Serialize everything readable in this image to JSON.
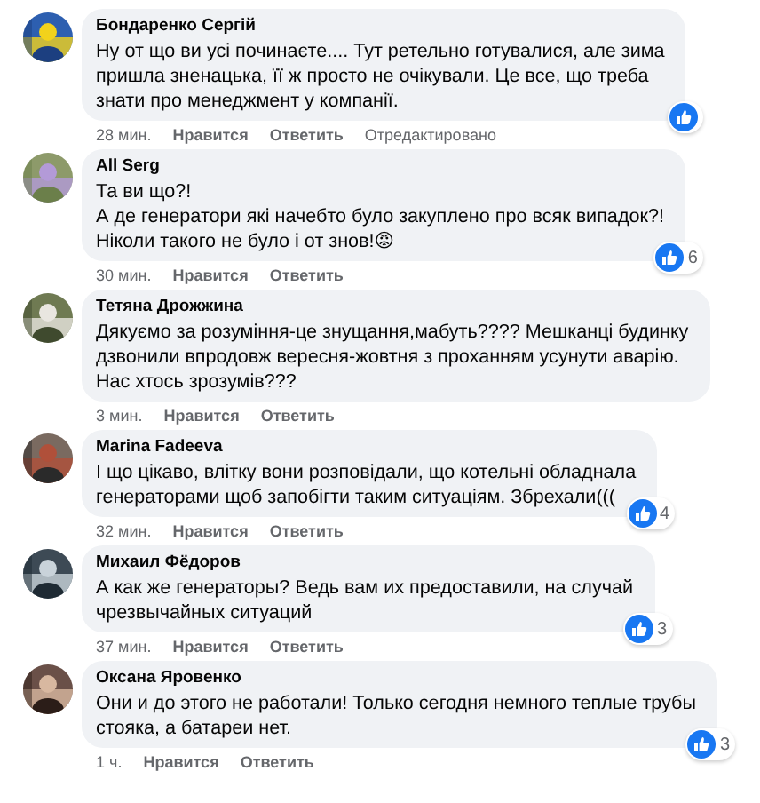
{
  "comments": [
    {
      "author": "Бондаренко Сергій",
      "lines": [
        "Ну от що ви усі починаєте.... Тут ретельно готувалися, але зима",
        "пришла зненацька, її ж просто не очікували. Це все, що треба",
        "знати про менеджмент у компанії."
      ],
      "time": "28 мин.",
      "like": "Нравится",
      "reply": "Ответить",
      "edited": "Отредактировано",
      "reaction": {
        "like": true
      }
    },
    {
      "author": "All Serg",
      "lines": [
        "Та ви що?!",
        "А де генератори які начебто було закуплено про всяк випадок?!",
        "Ніколи такого не було і от знов!😡"
      ],
      "time": "30 мин.",
      "like": "Нравится",
      "reply": "Ответить",
      "reaction": {
        "like": true,
        "count": "6"
      }
    },
    {
      "author": "Тетяна Дрожжина",
      "lines": [
        "Дякуємо за розуміння-це знущання,мабуть???? Мешканці будинку",
        "дзвонили впродовж вересня-жовтня з проханням усунути аварію.",
        "Нас хтось зрозумів???"
      ],
      "time": "3 мин.",
      "like": "Нравится",
      "reply": "Ответить"
    },
    {
      "author": "Marina Fadeeva",
      "lines": [
        "І що цікаво, влітку вони розповідали, що котельні обладнала",
        "генераторами щоб запобігти таким ситуаціям. Збрехали((("
      ],
      "time": "32 мин.",
      "like": "Нравится",
      "reply": "Ответить",
      "reaction": {
        "like": true,
        "count": "4"
      }
    },
    {
      "author": "Михаил Фёдоров",
      "lines": [
        "А как же генераторы? Ведь вам их предоставили, на случай",
        "чрезвычайных ситуаций"
      ],
      "time": "37 мин.",
      "like": "Нравится",
      "reply": "Ответить",
      "reaction": {
        "like": true,
        "count": "3"
      }
    },
    {
      "author": "Оксана Яровенко",
      "lines": [
        "Они и до этого не работали! Только сегодня немного теплые трубы",
        "стояка, а батареи нет."
      ],
      "time": "1 ч.",
      "like": "Нравится",
      "reply": "Ответить",
      "reaction": {
        "like": true,
        "count": "3"
      }
    }
  ]
}
